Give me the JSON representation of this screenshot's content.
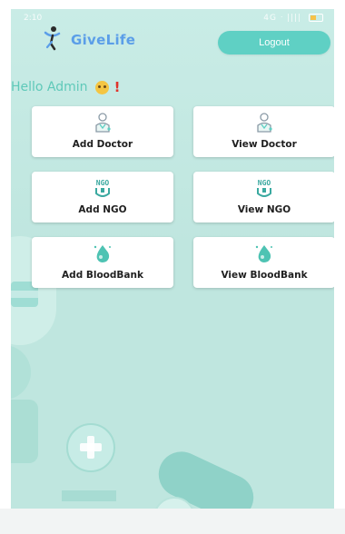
{
  "status_bar": {
    "time": "2:10",
    "indicators": "4G ᐧ ||||"
  },
  "app": {
    "name": "GiveLife",
    "logout_label": "Logout"
  },
  "greeting": {
    "text": "Hello Admin",
    "exclaim": "!"
  },
  "cards": [
    {
      "label": "Add Doctor",
      "icon": "doctor-icon"
    },
    {
      "label": "View Doctor",
      "icon": "doctor-icon"
    },
    {
      "label": "Add NGO",
      "icon": "ngo-icon"
    },
    {
      "label": "View NGO",
      "icon": "ngo-icon"
    },
    {
      "label": "Add BloodBank",
      "icon": "blood-drop-icon"
    },
    {
      "label": "View BloodBank",
      "icon": "blood-drop-icon"
    }
  ],
  "icon_text": {
    "ngo": "NGO"
  },
  "colors": {
    "accent": "#5fd0c4",
    "brand": "#5b9ee8",
    "background": "#c9ece6"
  }
}
